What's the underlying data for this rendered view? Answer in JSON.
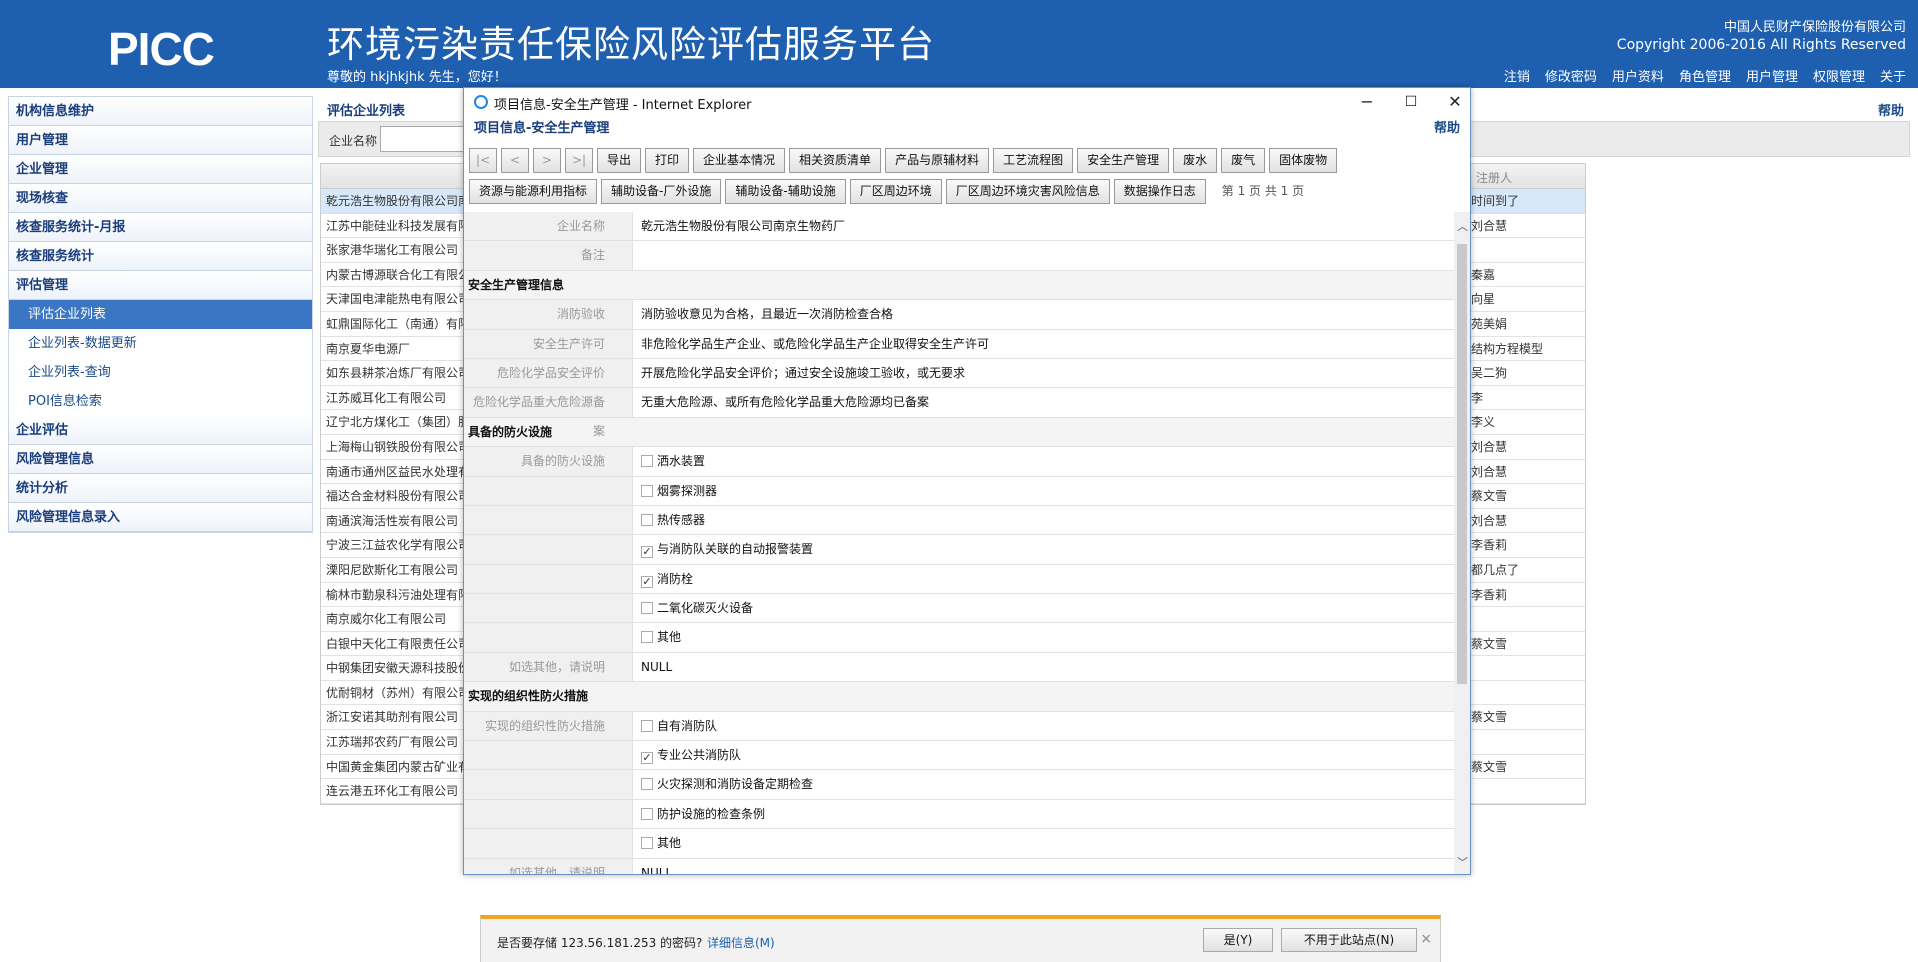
{
  "header": {
    "logo": "PICC",
    "title": "环境污染责任保险风险评估服务平台",
    "greeting": "尊敬的 hkjhkjhk 先生，您好！",
    "company": "中国人民财产保险股份有限公司",
    "copyright": "Copyright 2006-2016 All Rights Reserved",
    "nav": [
      "注销",
      "修改密码",
      "用户资料",
      "角色管理",
      "用户管理",
      "权限管理",
      "关于"
    ]
  },
  "sidebar": {
    "items": [
      {
        "label": "机构信息维护"
      },
      {
        "label": "用户管理"
      },
      {
        "label": "企业管理"
      },
      {
        "label": "现场核查"
      },
      {
        "label": "核查服务统计-月报"
      },
      {
        "label": "核查服务统计"
      },
      {
        "label": "评估管理"
      }
    ],
    "sub_items": [
      {
        "label": "评估企业列表"
      },
      {
        "label": "企业列表-数据更新"
      },
      {
        "label": "企业列表-查询"
      },
      {
        "label": "POI信息检索"
      }
    ],
    "bottom_items": [
      {
        "label": "企业评估"
      },
      {
        "label": "风险管理信息"
      },
      {
        "label": "统计分析"
      },
      {
        "label": "风险管理信息录入"
      }
    ]
  },
  "main": {
    "breadcrumb": "评估企业列表",
    "help": "帮助",
    "search_label": "企业名称",
    "table_header_registrant": "注册人",
    "rows": [
      {
        "name": "乾元浩生物股份有限公司南",
        "reg": "时间到了"
      },
      {
        "name": "江苏中能硅业科技发展有限",
        "reg": "刘合慧"
      },
      {
        "name": "张家港华瑞化工有限公司",
        "reg": ""
      },
      {
        "name": "内蒙古博源联合化工有限公",
        "reg": "秦嘉"
      },
      {
        "name": "天津国电津能热电有限公司",
        "reg": "向星"
      },
      {
        "name": "虹鼎国际化工（南通）有限",
        "reg": "苑美娟"
      },
      {
        "name": "南京夏华电源厂",
        "reg": "结构方程模型"
      },
      {
        "name": "如东县耕茶冶炼厂有限公司",
        "reg": "吴二狗"
      },
      {
        "name": "江苏威耳化工有限公司",
        "reg": "李"
      },
      {
        "name": "辽宁北方煤化工（集团）股",
        "reg": "李义"
      },
      {
        "name": "上海梅山钢铁股份有限公司",
        "reg": "刘合慧"
      },
      {
        "name": "南通市通州区益民水处理有",
        "reg": "刘合慧"
      },
      {
        "name": "福达合金材料股份有限公司",
        "reg": "蔡文雪"
      },
      {
        "name": "南通滨海活性炭有限公司",
        "reg": "刘合慧"
      },
      {
        "name": "宁波三江益农化学有限公司",
        "reg": "李香莉"
      },
      {
        "name": "溧阳尼欧斯化工有限公司",
        "reg": "都几点了"
      },
      {
        "name": "榆林市勤泉科污油处理有限",
        "reg": "李香莉"
      },
      {
        "name": "南京威尔化工有限公司",
        "reg": ""
      },
      {
        "name": "白银中天化工有限责任公司",
        "reg": "蔡文雪"
      },
      {
        "name": "中钢集团安徽天源科技股份",
        "reg": ""
      },
      {
        "name": "优耐铜材（苏州）有限公司",
        "reg": ""
      },
      {
        "name": "浙江安诺其助剂有限公司",
        "reg": "蔡文雪"
      },
      {
        "name": "江苏瑞邦农药厂有限公司",
        "reg": ""
      },
      {
        "name": "中国黄金集团内蒙古矿业有",
        "reg": "蔡文雪"
      },
      {
        "name": "连云港五环化工有限公司",
        "reg": ""
      }
    ]
  },
  "popup": {
    "window_title": "项目信息-安全生产管理 - Internet Explorer",
    "header_title": "项目信息-安全生产管理",
    "help": "帮助",
    "nav_buttons": [
      "|<",
      "<",
      ">",
      ">|"
    ],
    "toolbar1": [
      "导出",
      "打印",
      "企业基本情况",
      "相关资质清单",
      "产品与原辅材料",
      "工艺流程图",
      "安全生产管理",
      "废水",
      "废气",
      "固体废物"
    ],
    "toolbar2": [
      "资源与能源利用指标",
      "辅助设备-厂外设施",
      "辅助设备-辅助设施",
      "厂区周边环境",
      "厂区周边环境灾害风险信息",
      "数据操作日志"
    ],
    "page_info": "第 1 页 共 1 页",
    "company_label": "企业名称",
    "company_value": "乾元浩生物股份有限公司南京生物药厂",
    "remark_label": "备注",
    "section1": "安全生产管理信息",
    "fire_label": "消防验收",
    "fire_value": "消防验收意见为合格，且最近一次消防检查合格",
    "permit_label": "安全生产许可",
    "permit_value": "非危险化学品生产企业、或危险化学品生产企业取得安全生产许可",
    "hazard_label": "危险化学品安全评价",
    "hazard_value": "开展危险化学品安全评价；通过安全设施竣工验收，或无要求",
    "major_label": "危险化学品重大危险源备案",
    "major_value": "无重大危险源、或所有危险化学品重大危险源均已备案",
    "section2": "具备的防火设施",
    "facility_label": "具备的防火设施",
    "facilities": [
      {
        "label": "洒水装置",
        "checked": false
      },
      {
        "label": "烟雾探测器",
        "checked": false
      },
      {
        "label": "热传感器",
        "checked": false
      },
      {
        "label": "与消防队关联的自动报警装置",
        "checked": true
      },
      {
        "label": "消防栓",
        "checked": true
      },
      {
        "label": "二氧化碳灭火设备",
        "checked": false
      },
      {
        "label": "其他",
        "checked": false
      }
    ],
    "other_label": "如选其他，请说明",
    "other_value": "NULL",
    "section3": "实现的组织性防火措施",
    "measures_label": "实现的组织性防火措施",
    "measures": [
      {
        "label": "自有消防队",
        "checked": false
      },
      {
        "label": "专业公共消防队",
        "checked": true
      },
      {
        "label": "火灾探测和消防设备定期检查",
        "checked": false
      },
      {
        "label": "防护设施的检查条例",
        "checked": false
      },
      {
        "label": "其他",
        "checked": false
      }
    ],
    "other2_label": "如选其他，请说明",
    "other2_value": "NULL"
  },
  "notification": {
    "text": "是否要存储 123.56.181.253 的密码?",
    "link": "详细信息(M)",
    "yes": "是(Y)",
    "no": "不用于此站点(N)",
    "close": "×"
  },
  "colors": {
    "header_bg": "#1e5fb0",
    "accent": "#3b76c4",
    "notify_border": "#f0a520"
  }
}
